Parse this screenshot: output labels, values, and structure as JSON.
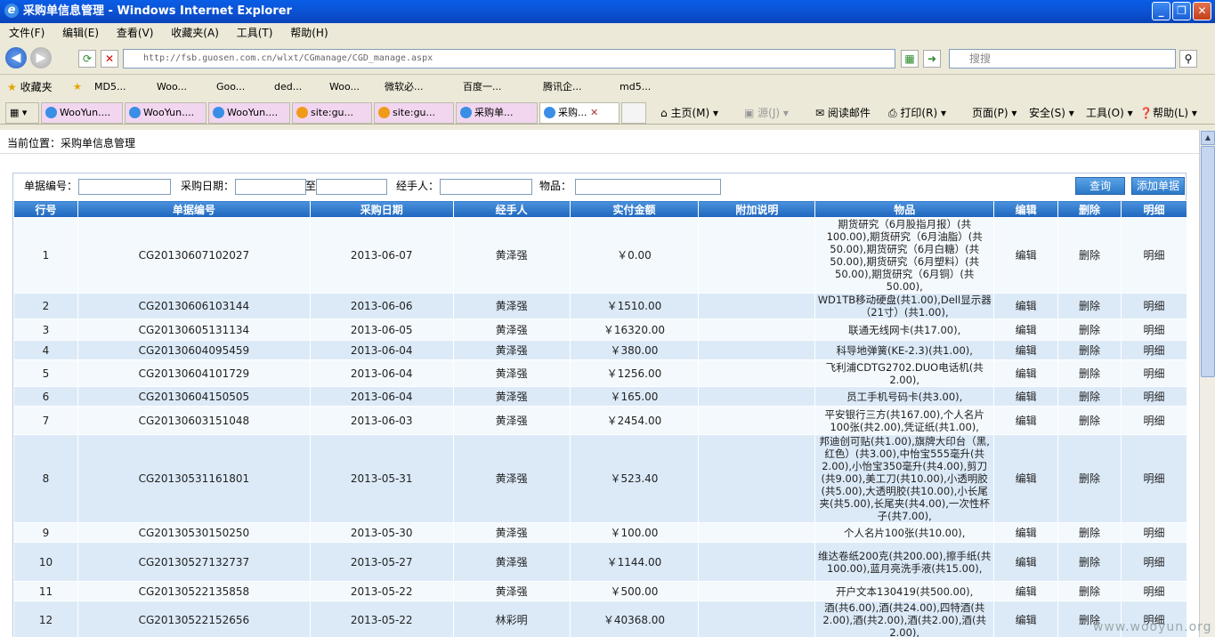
{
  "window": {
    "title": "采购单信息管理 - Windows Internet Explorer"
  },
  "menu": [
    "文件(F)",
    "编辑(E)",
    "查看(V)",
    "收藏夹(A)",
    "工具(T)",
    "帮助(H)"
  ],
  "address": {
    "url": "http://fsb.guosen.com.cn/wlxt/CGmanage/CGD_manage.aspx",
    "search_placeholder": "搜搜"
  },
  "favorites": {
    "label": "收藏夹",
    "items": [
      "MD5...",
      "Woo...",
      "Goo...",
      "ded...",
      "Woo...",
      "微软必...",
      "百度一...",
      "腾讯企...",
      "md5..."
    ]
  },
  "tabs": [
    "WooYun....",
    "WooYun....",
    "WooYun....",
    "site:gu...",
    "site:gu...",
    "采购单...",
    "采购..."
  ],
  "commands": [
    "主页(M)",
    "源(J)",
    "阅读邮件",
    "打印(R)",
    "页面(P)",
    "安全(S)",
    "工具(O)",
    "帮助(L)"
  ],
  "page": {
    "breadcrumb": "当前位置：采购单信息管理",
    "filter": {
      "doc_no": "单据编号：",
      "date": "采购日期：",
      "to": "至",
      "handler": "经手人：",
      "goods": "物品：",
      "query": "查询",
      "add": "添加单据"
    },
    "columns": [
      "行号",
      "单据编号",
      "采购日期",
      "经手人",
      "实付金额",
      "附加说明",
      "物品",
      "编辑",
      "删除",
      "明细"
    ],
    "rows": [
      {
        "no": "1",
        "id": "CG20130607102027",
        "date": "2013-06-07",
        "handler": "黄泽强",
        "amount": "￥0.00",
        "note": "",
        "items": "期货研究（6月股指月报）(共100.00),期货研究（6月油脂）(共50.00),期货研究（6月白糖）(共50.00),期货研究（6月塑料）(共50.00),期货研究（6月铜）(共50.00),",
        "edit": "编辑",
        "del": "删除",
        "detail": "明细"
      },
      {
        "no": "2",
        "id": "CG20130606103144",
        "date": "2013-06-06",
        "handler": "黄泽强",
        "amount": "￥1510.00",
        "note": "",
        "items": "WD1TB移动硬盘(共1.00),Dell显示器（21寸）(共1.00),",
        "edit": "编辑",
        "del": "删除",
        "detail": "明细"
      },
      {
        "no": "3",
        "id": "CG20130605131134",
        "date": "2013-06-05",
        "handler": "黄泽强",
        "amount": "￥16320.00",
        "note": "",
        "items": "联通无线网卡(共17.00),",
        "edit": "编辑",
        "del": "删除",
        "detail": "明细"
      },
      {
        "no": "4",
        "id": "CG20130604095459",
        "date": "2013-06-04",
        "handler": "黄泽强",
        "amount": "￥380.00",
        "note": "",
        "items": "科导地弹簧(KE-2.3)(共1.00),",
        "edit": "编辑",
        "del": "删除",
        "detail": "明细"
      },
      {
        "no": "5",
        "id": "CG20130604101729",
        "date": "2013-06-04",
        "handler": "黄泽强",
        "amount": "￥1256.00",
        "note": "",
        "items": "飞利浦CDTG2702.DUO电话机(共2.00),",
        "edit": "编辑",
        "del": "删除",
        "detail": "明细"
      },
      {
        "no": "6",
        "id": "CG20130604150505",
        "date": "2013-06-04",
        "handler": "黄泽强",
        "amount": "￥165.00",
        "note": "",
        "items": "员工手机号码卡(共3.00),",
        "edit": "编辑",
        "del": "删除",
        "detail": "明细"
      },
      {
        "no": "7",
        "id": "CG20130603151048",
        "date": "2013-06-03",
        "handler": "黄泽强",
        "amount": "￥2454.00",
        "note": "",
        "items": "平安银行三方(共167.00),个人名片100张(共2.00),凭证纸(共1.00),",
        "edit": "编辑",
        "del": "删除",
        "detail": "明细"
      },
      {
        "no": "8",
        "id": "CG20130531161801",
        "date": "2013-05-31",
        "handler": "黄泽强",
        "amount": "￥523.40",
        "note": "",
        "items": "邦迪创可贴(共1.00),旗牌大印台（黑,红色）(共3.00),中怡宝555毫升(共2.00),小怡宝350毫升(共4.00),剪刀(共9.00),美工刀(共10.00),小透明胶(共5.00),大透明胶(共10.00),小长尾夹(共5.00),长尾夹(共4.00),一次性杯子(共7.00),",
        "edit": "编辑",
        "del": "删除",
        "detail": "明细"
      },
      {
        "no": "9",
        "id": "CG20130530150250",
        "date": "2013-05-30",
        "handler": "黄泽强",
        "amount": "￥100.00",
        "note": "",
        "items": "个人名片100张(共10.00),",
        "edit": "编辑",
        "del": "删除",
        "detail": "明细"
      },
      {
        "no": "10",
        "id": "CG20130527132737",
        "date": "2013-05-27",
        "handler": "黄泽强",
        "amount": "￥1144.00",
        "note": "",
        "items": "维达卷纸200克(共200.00),擦手纸(共100.00),蓝月亮洗手液(共15.00),",
        "edit": "编辑",
        "del": "删除",
        "detail": "明细"
      },
      {
        "no": "11",
        "id": "CG20130522135858",
        "date": "2013-05-22",
        "handler": "黄泽强",
        "amount": "￥500.00",
        "note": "",
        "items": "开户文本130419(共500.00),",
        "edit": "编辑",
        "del": "删除",
        "detail": "明细"
      },
      {
        "no": "12",
        "id": "CG20130522152656",
        "date": "2013-05-22",
        "handler": "林彩明",
        "amount": "￥40368.00",
        "note": "",
        "items": "酒(共6.00),酒(共24.00),四特酒(共2.00),酒(共2.00),酒(共2.00),酒(共2.00),",
        "edit": "编辑",
        "del": "删除",
        "detail": "明细"
      }
    ]
  },
  "watermark": "www.wooyun.org"
}
